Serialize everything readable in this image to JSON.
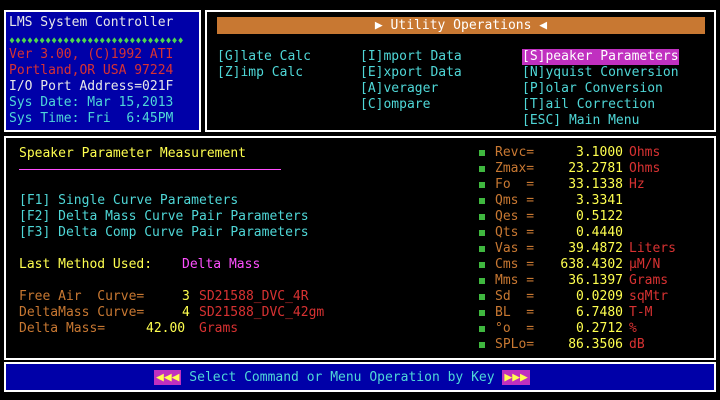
{
  "system": {
    "title": "LMS System Controller",
    "diamonds": "♦♦♦♦♦♦♦♦♦♦♦♦♦♦♦♦♦♦♦♦♦♦♦♦♦♦♦♦♦",
    "version": "Ver 3.00, (C)1992 ATI",
    "location": "Portland,OR USA 97224",
    "io_port": "I/O Port Address=021F",
    "sys_date": "Sys Date: Mar 15,2013",
    "sys_time": "Sys Time: Fri  6:45PM"
  },
  "menu": {
    "title": "▶ Utility Operations ◀",
    "col1": [
      "[G]late Calc",
      "[Z]imp Calc"
    ],
    "col2": [
      "[I]mport Data",
      "[E]xport Data",
      "[A]verager",
      "[C]ompare"
    ],
    "col3": [
      "[S]peaker Parameters",
      "[N]yquist Conversion",
      "[P]olar Conversion",
      "[T]ail Correction",
      "[ESC] Main Menu"
    ]
  },
  "main": {
    "heading": "Speaker Parameter Measurement",
    "options": [
      "[F1] Single Curve Parameters",
      "[F2] Delta Mass Curve Pair Parameters",
      "[F3] Delta Comp Curve Pair Parameters"
    ],
    "last_method_label": "Last Method Used:",
    "last_method_value": "Delta Mass",
    "free_air_label": "Free Air  Curve=",
    "free_air_num": "3",
    "free_air_name": "SD21588_DVC_4R",
    "delta_curve_label": "DeltaMass Curve=",
    "delta_curve_num": "4",
    "delta_curve_name": "SD21588_DVC_42gm",
    "delta_mass_label": "Delta Mass=",
    "delta_mass_value": "42.00",
    "delta_mass_unit": "Grams"
  },
  "params": [
    {
      "name": "Revc=",
      "value": "3.1000",
      "unit": "Ohms"
    },
    {
      "name": "Zmax=",
      "value": "23.2781",
      "unit": "Ohms"
    },
    {
      "name": "Fo  =",
      "value": "33.1338",
      "unit": "Hz"
    },
    {
      "name": "Qms =",
      "value": "3.3341",
      "unit": ""
    },
    {
      "name": "Qes =",
      "value": "0.5122",
      "unit": ""
    },
    {
      "name": "Qts =",
      "value": "0.4440",
      "unit": ""
    },
    {
      "name": "Vas =",
      "value": "39.4872",
      "unit": "Liters"
    },
    {
      "name": "Cms =",
      "value": "638.4302",
      "unit": "µM/N"
    },
    {
      "name": "Mms =",
      "value": "36.1397",
      "unit": "Grams"
    },
    {
      "name": "Sd  =",
      "value": "0.0209",
      "unit": "sqMtr"
    },
    {
      "name": "BL  =",
      "value": "6.7480",
      "unit": "T-M"
    },
    {
      "name": "°o  =",
      "value": "0.2712",
      "unit": "%"
    },
    {
      "name": "SPLo=",
      "value": "86.3506",
      "unit": "dB"
    }
  ],
  "status": {
    "left_arrows": "◀◀◀",
    "text": " Select Command or Menu Operation by Key ",
    "right_arrows": "▶▶▶"
  }
}
